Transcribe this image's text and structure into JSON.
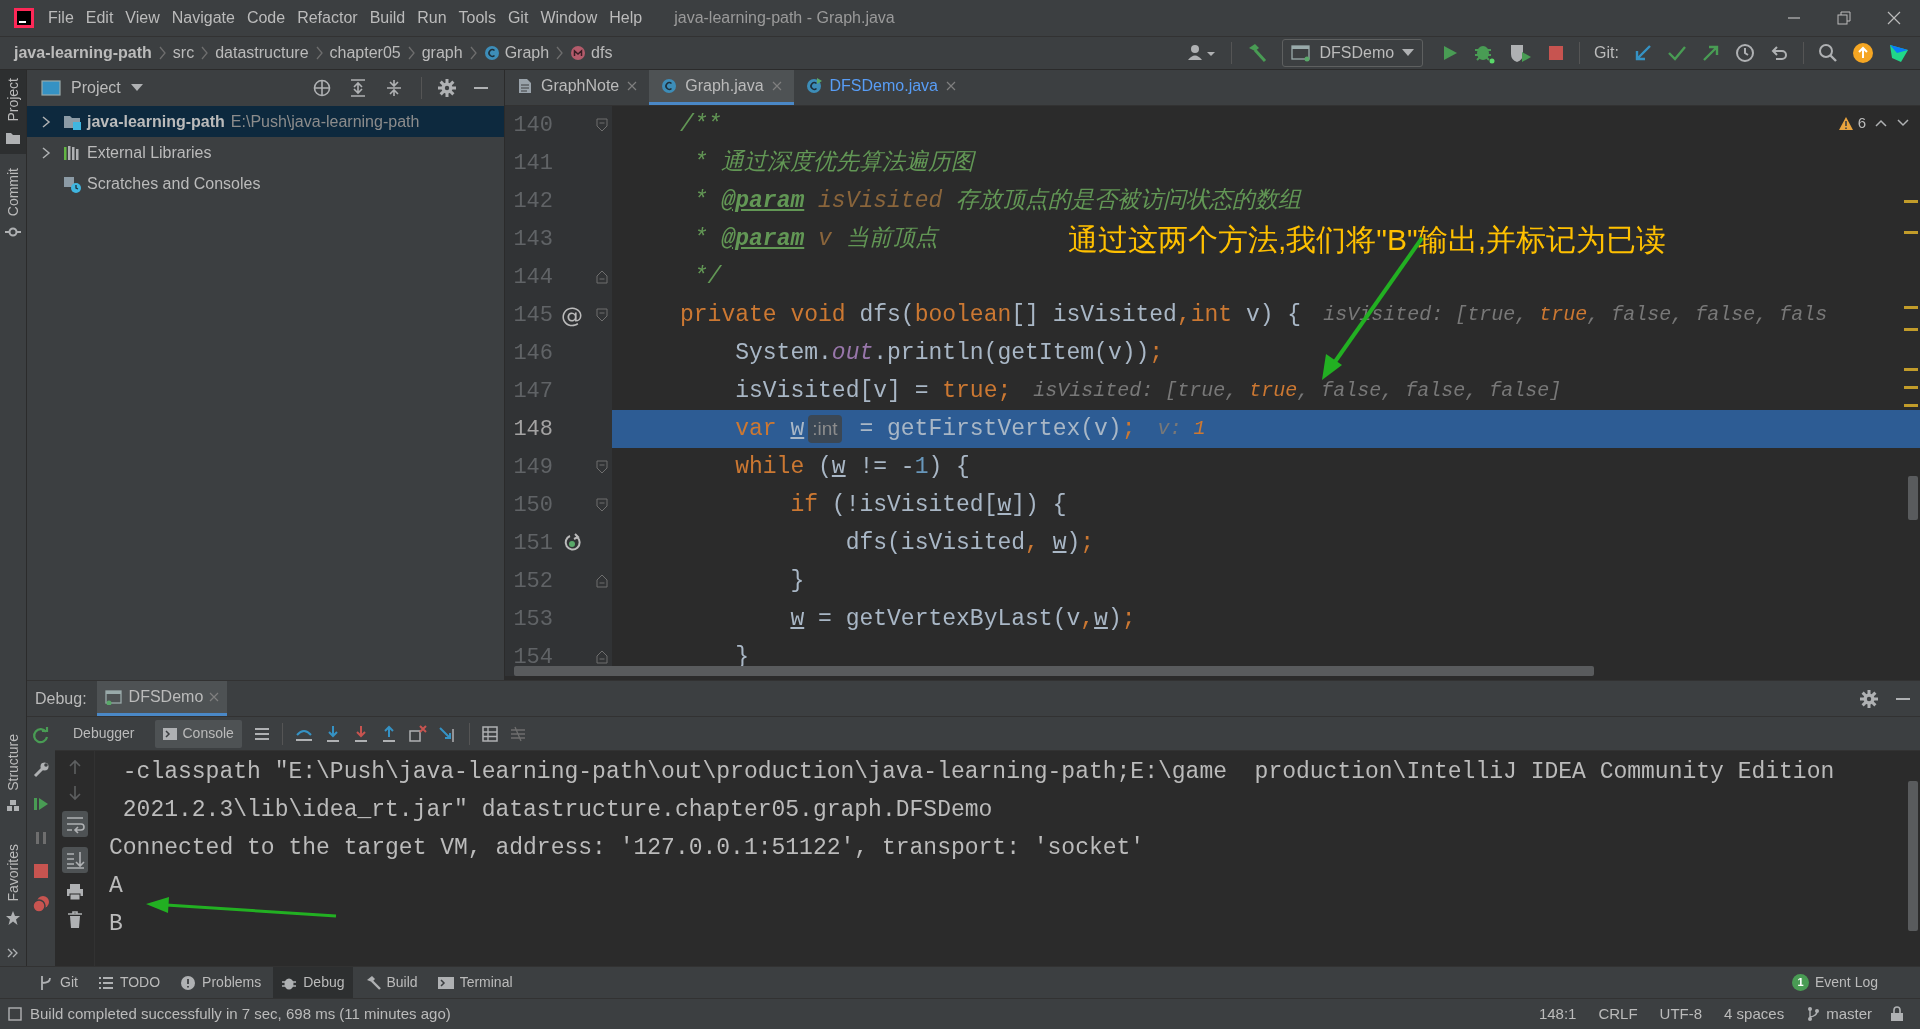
{
  "window": {
    "title": "java-learning-path - Graph.java"
  },
  "menu": [
    "File",
    "Edit",
    "View",
    "Navigate",
    "Code",
    "Refactor",
    "Build",
    "Run",
    "Tools",
    "Git",
    "Window",
    "Help"
  ],
  "breadcrumbs": [
    {
      "label": "java-learning-path",
      "kind": "project"
    },
    {
      "label": "src",
      "kind": "folder"
    },
    {
      "label": "datastructure",
      "kind": "folder"
    },
    {
      "label": "chapter05",
      "kind": "folder"
    },
    {
      "label": "graph",
      "kind": "folder"
    },
    {
      "label": "Graph",
      "kind": "class"
    },
    {
      "label": "dfs",
      "kind": "method"
    }
  ],
  "toolbar": {
    "run_configuration": "DFSDemo",
    "git_label": "Git:"
  },
  "left_stripe": {
    "top": [
      {
        "label": "Project",
        "kind": "project",
        "selected": true
      },
      {
        "label": "Commit",
        "kind": "commit",
        "selected": false
      }
    ],
    "bottom": [
      {
        "label": "Structure",
        "kind": "structure",
        "selected": false
      },
      {
        "label": "Favorites",
        "kind": "favorites",
        "selected": false
      }
    ]
  },
  "project_panel": {
    "title": "Project",
    "tree": [
      {
        "label": "java-learning-path",
        "path": "E:\\Push\\java-learning-path",
        "kind": "module",
        "expanded": false,
        "selected": true
      },
      {
        "label": "External Libraries",
        "kind": "libraries",
        "expanded": false,
        "selected": false
      },
      {
        "label": "Scratches and Consoles",
        "kind": "scratches",
        "selected": false
      }
    ]
  },
  "editor": {
    "tabs": [
      {
        "label": "GraphNote",
        "kind": "note",
        "selected": false
      },
      {
        "label": "Graph.java",
        "kind": "class",
        "selected": true
      },
      {
        "label": "DFSDemo.java",
        "kind": "runnable",
        "selected": false
      }
    ],
    "warnings": "6",
    "lines": [
      {
        "number": "140",
        "fold": {
          "kind": "start"
        },
        "current": false,
        "segments": [
          {
            "kind": "code",
            "tokens": [
              {
                "text": "/**",
                "kind": "doc"
              }
            ]
          }
        ]
      },
      {
        "number": "141",
        "current": false,
        "segments": [
          {
            "kind": "code",
            "tokens": [
              {
                "text": " * 通过深度优先算法遍历图",
                "kind": "doc"
              }
            ]
          }
        ]
      },
      {
        "number": "142",
        "current": false,
        "segments": [
          {
            "kind": "code",
            "tokens": [
              {
                "text": " * ",
                "kind": "doc"
              },
              {
                "text": "@param",
                "kind": "doc_tag"
              },
              {
                "text": " isVisited",
                "kind": "doc_param"
              },
              {
                "text": " 存放顶点的是否被访问状态的数组",
                "kind": "doc"
              }
            ]
          }
        ]
      },
      {
        "number": "143",
        "current": false,
        "segments": [
          {
            "kind": "code",
            "tokens": [
              {
                "text": " * ",
                "kind": "doc"
              },
              {
                "text": "@param",
                "kind": "doc_tag"
              },
              {
                "text": " v",
                "kind": "doc_param"
              },
              {
                "text": " 当前顶点",
                "kind": "doc"
              }
            ]
          }
        ]
      },
      {
        "number": "144",
        "fold": {
          "kind": "end"
        },
        "current": false,
        "segments": [
          {
            "kind": "code",
            "tokens": [
              {
                "text": " */",
                "kind": "doc"
              }
            ]
          }
        ]
      },
      {
        "number": "145",
        "fold": {
          "kind": "start"
        },
        "gutter_mark": "@",
        "current": false,
        "segments": [
          {
            "kind": "code",
            "tokens": [
              {
                "text": "private void",
                "kind": "keyword"
              },
              {
                "text": " dfs(",
                "kind": "plain"
              },
              {
                "text": "boolean",
                "kind": "keyword"
              },
              {
                "text": "[] isVisited",
                "kind": "plain"
              },
              {
                "text": ",int",
                "kind": "keyword"
              },
              {
                "text": " v) {",
                "kind": "plain"
              }
            ]
          },
          {
            "kind": "debug_hint",
            "tokens": [
              {
                "text": "isVisited: [true, ",
                "kind": "hint"
              },
              {
                "text": "true",
                "kind": "hint_value"
              },
              {
                "text": ", false, false, fals",
                "kind": "hint"
              }
            ]
          }
        ]
      },
      {
        "number": "146",
        "current": false,
        "segments": [
          {
            "kind": "code",
            "tokens": [
              {
                "text": "    System.",
                "kind": "plain"
              },
              {
                "text": "out",
                "kind": "static_field"
              },
              {
                "text": ".println(getItem(v))",
                "kind": "plain"
              },
              {
                "text": ";",
                "kind": "keyword"
              }
            ]
          }
        ]
      },
      {
        "number": "147",
        "current": false,
        "segments": [
          {
            "kind": "code",
            "tokens": [
              {
                "text": "    isVisited[v] = ",
                "kind": "plain"
              },
              {
                "text": "true;",
                "kind": "keyword"
              }
            ]
          },
          {
            "kind": "debug_hint",
            "tokens": [
              {
                "text": "isVisited: [true, ",
                "kind": "hint"
              },
              {
                "text": "true",
                "kind": "hint_value"
              },
              {
                "text": ", false, false, false]",
                "kind": "hint"
              }
            ]
          }
        ]
      },
      {
        "number": "148",
        "current": true,
        "segments": [
          {
            "kind": "code",
            "tokens": [
              {
                "text": "    var ",
                "kind": "keyword"
              },
              {
                "text": "w",
                "kind": "var"
              }
            ]
          },
          {
            "kind": "type_hint",
            "text": ":int"
          },
          {
            "kind": "code",
            "tokens": [
              {
                "text": " = getFirstVertex(v)",
                "kind": "plain"
              },
              {
                "text": ";",
                "kind": "keyword"
              }
            ]
          },
          {
            "kind": "debug_hint",
            "tokens": [
              {
                "text": "v: ",
                "kind": "hint"
              },
              {
                "text": "1",
                "kind": "hint_value"
              }
            ]
          }
        ]
      },
      {
        "number": "149",
        "fold": {
          "kind": "start"
        },
        "current": false,
        "segments": [
          {
            "kind": "code",
            "tokens": [
              {
                "text": "    while",
                "kind": "keyword"
              },
              {
                "text": " (",
                "kind": "plain"
              },
              {
                "text": "w",
                "kind": "var"
              },
              {
                "text": " != -",
                "kind": "plain"
              },
              {
                "text": "1",
                "kind": "number"
              },
              {
                "text": ") {",
                "kind": "plain"
              }
            ]
          }
        ]
      },
      {
        "number": "150",
        "fold": {
          "kind": "start"
        },
        "current": false,
        "segments": [
          {
            "kind": "code",
            "tokens": [
              {
                "text": "        if",
                "kind": "keyword"
              },
              {
                "text": " (!isVisited[",
                "kind": "plain"
              },
              {
                "text": "w",
                "kind": "var"
              },
              {
                "text": "]) {",
                "kind": "plain"
              }
            ]
          }
        ]
      },
      {
        "number": "151",
        "gutter_icon": {
          "kind": "recursion"
        },
        "current": false,
        "segments": [
          {
            "kind": "code",
            "tokens": [
              {
                "text": "            dfs(isVisited",
                "kind": "plain"
              },
              {
                "text": ",",
                "kind": "keyword"
              },
              {
                "text": " w",
                "kind": "var"
              },
              {
                "text": ")",
                "kind": "plain"
              },
              {
                "text": ";",
                "kind": "keyword"
              }
            ]
          }
        ]
      },
      {
        "number": "152",
        "fold": {
          "kind": "end"
        },
        "current": false,
        "segments": [
          {
            "kind": "code",
            "tokens": [
              {
                "text": "        }",
                "kind": "plain"
              }
            ]
          }
        ]
      },
      {
        "number": "153",
        "current": false,
        "segments": [
          {
            "kind": "code",
            "tokens": [
              {
                "text": "        w",
                "kind": "var"
              },
              {
                "text": " = getVertexByLast(v",
                "kind": "plain"
              },
              {
                "text": ",",
                "kind": "keyword"
              },
              {
                "text": "w",
                "kind": "var"
              },
              {
                "text": ")",
                "kind": "plain"
              },
              {
                "text": ";",
                "kind": "keyword"
              }
            ]
          }
        ]
      },
      {
        "number": "154",
        "fold": {
          "kind": "end"
        },
        "current": false,
        "segments": [
          {
            "kind": "code",
            "tokens": [
              {
                "text": "    }",
                "kind": "plain"
              }
            ]
          }
        ]
      }
    ],
    "annotation": "通过这两个方法,我们将\"B\"输出,并标记为已读"
  },
  "debug": {
    "title": "Debug:",
    "session": "DFSDemo",
    "tabs": [
      {
        "label": "Debugger",
        "kind": "debugger",
        "selected": false
      },
      {
        "label": "Console",
        "kind": "console",
        "selected": true
      }
    ],
    "console": [
      " -classpath \"E:\\Push\\java-learning-path\\out\\production\\java-learning-path;E:\\game  production\\IntelliJ IDEA Community Edition",
      " 2021.2.3\\lib\\idea_rt.jar\" datastructure.chapter05.graph.DFSDemo",
      "Connected to the target VM, address: '127.0.0.1:51122', transport: 'socket'",
      "A",
      "B"
    ]
  },
  "bottom_tools": [
    {
      "label": "Git",
      "kind": "git",
      "selected": false
    },
    {
      "label": "TODO",
      "kind": "todo",
      "selected": false
    },
    {
      "label": "Problems",
      "kind": "problems",
      "selected": false
    },
    {
      "label": "Debug",
      "kind": "debug",
      "selected": true
    },
    {
      "label": "Build",
      "kind": "build",
      "selected": false
    },
    {
      "label": "Terminal",
      "kind": "terminal",
      "selected": false
    },
    {
      "label": "Event Log",
      "kind": "event_log",
      "badge": "1",
      "selected": false
    }
  ],
  "status_bar": {
    "message": "Build completed successfully in 7 sec, 698 ms (11 minutes ago)",
    "items": [
      "148:1",
      "CRLF",
      "UTF-8",
      "4 spaces"
    ],
    "branch": "master"
  }
}
